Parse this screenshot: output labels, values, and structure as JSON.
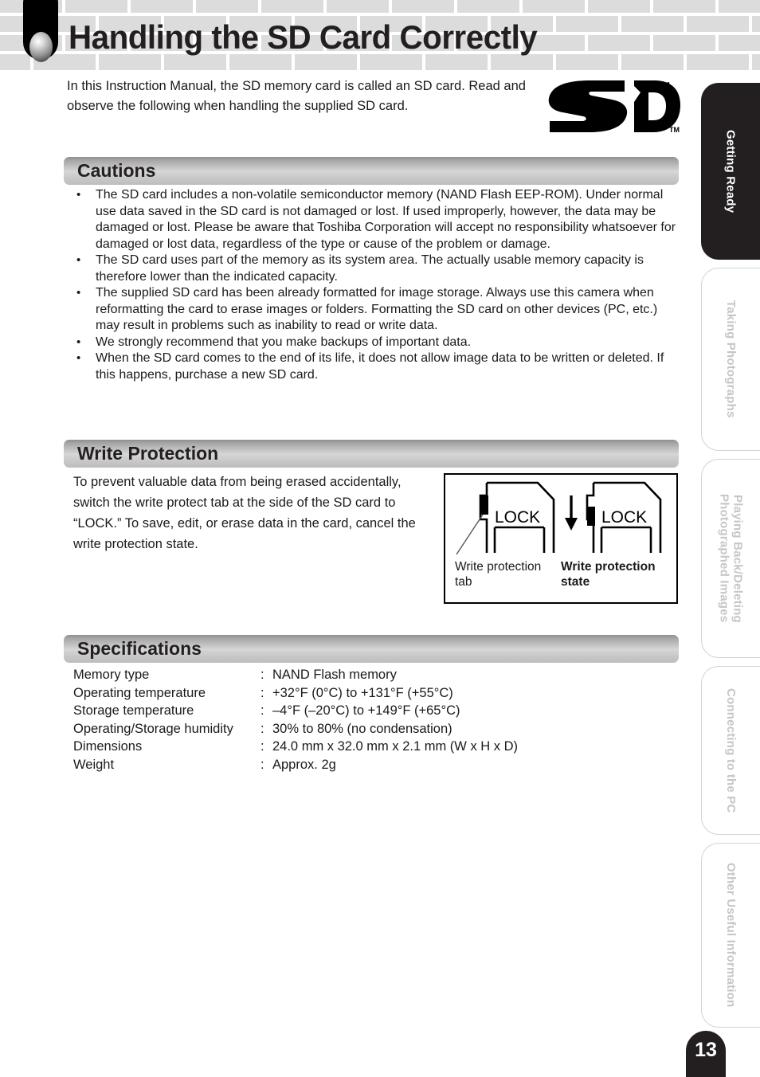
{
  "header": {
    "title": "Handling the SD Card Correctly"
  },
  "intro": {
    "text": "In this Instruction Manual, the SD memory card is called an SD card. Read and observe the following when handling the supplied SD card."
  },
  "logo": {
    "name": "SD",
    "trademark": "TM"
  },
  "sections": {
    "cautions": {
      "title": "Cautions",
      "bullets": [
        "The SD card includes a non-volatile semiconductor memory (NAND Flash EEP-ROM). Under normal use data saved in the SD card is not damaged or lost. If used improperly, however, the data may be damaged or lost. Please be aware that Toshiba Corporation will accept no responsibility whatsoever for damaged or lost data, regardless of the type or cause of the problem or damage.",
        "The SD card uses part of the memory as its system area. The actually usable memory capacity is therefore lower than the indicated capacity.",
        "The supplied SD card has been already formatted for image storage. Always use this camera when reformatting the card to erase images or folders. Formatting the SD card on other devices (PC, etc.) may result in problems such as inability to read or write data.",
        "We strongly recommend that you make backups of important data.",
        "When the SD card comes to the end of its life, it does not allow image data to be written or deleted. If this happens, purchase a new SD card."
      ]
    },
    "write_protection": {
      "title": "Write Protection",
      "body": "To prevent valuable data from being erased accidentally, switch the write protect tab at the side of the SD card to “LOCK.” To save, edit, or erase data in the card, cancel the write protection state.",
      "figure": {
        "card_left_lock_label": "LOCK",
        "card_right_lock_label": "LOCK",
        "caption_left": "Write protection tab",
        "caption_right": "Write protection state"
      }
    },
    "specifications": {
      "title": "Specifications",
      "separator": ":",
      "rows": [
        {
          "label": "Memory type",
          "value": "NAND Flash memory"
        },
        {
          "label": "Operating temperature",
          "value": "+32°F (0°C) to +131°F (+55°C)"
        },
        {
          "label": "Storage temperature",
          "value": "–4°F (–20°C) to +149°F (+65°C)"
        },
        {
          "label": "Operating/Storage humidity",
          "value": "30% to 80% (no condensation)"
        },
        {
          "label": "Dimensions",
          "value": "24.0 mm x 32.0 mm x 2.1 mm (W x H x D)"
        },
        {
          "label": "Weight",
          "value": "Approx. 2g"
        }
      ]
    }
  },
  "side_tabs": [
    {
      "label": "Getting Ready",
      "active": true
    },
    {
      "label": "Taking Photographs",
      "active": false
    },
    {
      "label": "Playing Back/Deleting Photographed Images",
      "active": false
    },
    {
      "label": "Connecting to the PC",
      "active": false
    },
    {
      "label": "Other Useful Information",
      "active": false
    }
  ],
  "page_number": "13",
  "colors": {
    "brick": "#dcdcdc",
    "ink": "#231f20",
    "tab_inactive_text": "#c6c6c6",
    "bar_gradient_top": "#8f8f8f",
    "bar_gradient_bottom": "#bdbdbd"
  }
}
